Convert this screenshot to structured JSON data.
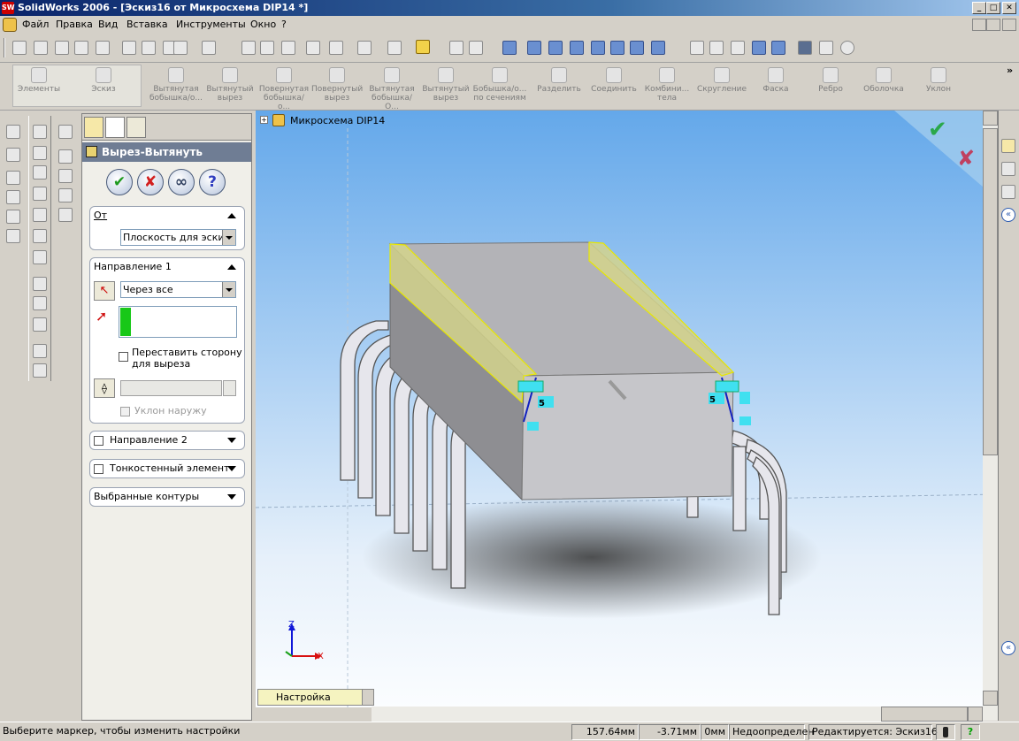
{
  "window": {
    "title": "SolidWorks 2006 - [Эскиз16 от Микросхема DIP14 *]",
    "logo": "SW"
  },
  "menu": [
    "Файл",
    "Правка",
    "Вид",
    "Вставка",
    "Инструменты",
    "Окно",
    "?"
  ],
  "feature_toolbar": {
    "tabs": [
      "Элементы",
      "Эскиз"
    ],
    "items": [
      "Вытянутая бобышка/о...",
      "Вытянутый вырез",
      "Повернутая бобышка/о...",
      "Повернутый вырез",
      "Вытянутая бобышка/О...",
      "Вытянутый вырез",
      "Бобышка/о... по сечениям",
      "Разделить",
      "Соединить",
      "Комбини... тела",
      "Скругление",
      "Фаска",
      "Ребро",
      "Оболочка",
      "Уклон"
    ],
    "overflow": "»"
  },
  "property_manager": {
    "title": "Вырез-Вытянуть",
    "buttons": {
      "ok": "✔",
      "cancel": "✘",
      "preview": "∞",
      "help": "?"
    },
    "from": {
      "label": "От",
      "value": "Плоскость для эскиза"
    },
    "direction1": {
      "label": "Направление 1",
      "end_condition": "Через все",
      "flip_label": "Переставить сторону для выреза",
      "draft_label": "Уклон наружу"
    },
    "collapsed": [
      "Направление 2",
      "Тонкостенный элемент",
      "Выбранные контуры"
    ]
  },
  "viewport": {
    "tree_item": "Микросхема DIP14",
    "config_box": "Настройка",
    "dims": [
      "5",
      "5"
    ],
    "axes": {
      "x": "X",
      "z": "Z"
    },
    "confirm": {
      "ok": "✔",
      "cancel": "✘"
    }
  },
  "status": {
    "message": "Выберите маркер, чтобы изменить настройки",
    "x": "157.64мм",
    "y": "-3.71мм",
    "z": "0мм",
    "state": "Недоопределен",
    "editing": "Редактируется: Эскиз16",
    "help": "?"
  },
  "colors": {
    "title_start": "#0a246a",
    "title_end": "#a6caf0",
    "pm_header": "#6f7d94",
    "part_body": "#c6c6ca",
    "part_top": "#b3b3b7",
    "yellow_face": "#d3d38c"
  }
}
